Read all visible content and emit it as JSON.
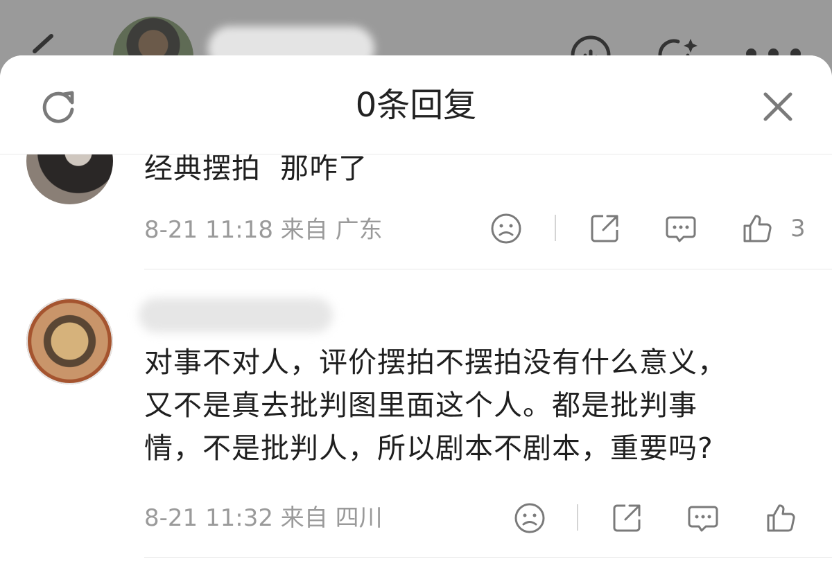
{
  "background": {
    "icons": [
      "back-icon",
      "avatar",
      "blurred-username",
      "timeline-icon",
      "ai-sparkle-icon",
      "more-icon"
    ]
  },
  "sheet": {
    "title": "0条回复",
    "icons": [
      "refresh-icon",
      "close-icon"
    ]
  },
  "comments": [
    {
      "text": "经典摆拍  那咋了",
      "time": "8-21 11:18",
      "from_label": "来自",
      "location": "广东",
      "like_count": "3",
      "actions": [
        "dislike-icon",
        "share-icon",
        "reply-icon",
        "like-icon"
      ]
    },
    {
      "text": "对事不对人，评价摆拍不摆拍没有什么意义，\n又不是真去批判图里面这个人。都是批判事\n情，不是批判人，所以剧本不剧本，重要吗?",
      "time": "8-21 11:32",
      "from_label": "来自",
      "location": "四川",
      "like_count": "",
      "actions": [
        "dislike-icon",
        "share-icon",
        "reply-icon",
        "like-icon"
      ]
    }
  ],
  "colors": {
    "overlay": "#9a9a9a",
    "text": "#1f1f1f",
    "meta": "#9a9a9a",
    "icon": "#7a7a7a"
  }
}
